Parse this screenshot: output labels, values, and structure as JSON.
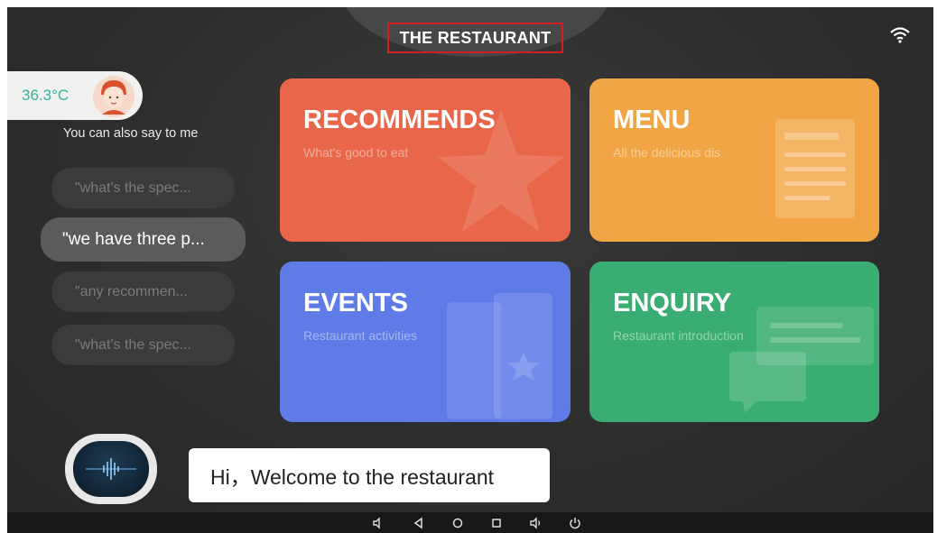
{
  "header": {
    "title": "THE RESTAURANT"
  },
  "status": {
    "temperature": "36.3°C"
  },
  "left_panel": {
    "hint": "You can also say to me",
    "suggestions": [
      "\"what's the spec...",
      "\"we have three p...",
      "\"any recommen...",
      "\"what's the spec..."
    ],
    "active_index": 1
  },
  "cards": [
    {
      "title": "RECOMMENDS",
      "subtitle": "What's good to eat",
      "color": "#e8674a",
      "icon": "star-icon"
    },
    {
      "title": "MENU",
      "subtitle": "All the delicious dis",
      "color": "#f2a544",
      "icon": "menu-document-icon"
    },
    {
      "title": "EVENTS",
      "subtitle": "Restaurant activities",
      "color": "#5f7be8",
      "icon": "ticket-icon"
    },
    {
      "title": "ENQUIRY",
      "subtitle": "Restaurant introduction",
      "color": "#3aad72",
      "icon": "chat-bubbles-icon"
    }
  ],
  "assistant": {
    "message": "Hi，Welcome to the restaurant"
  },
  "navbar": {
    "icons": [
      "volume-down-icon",
      "back-icon",
      "home-icon",
      "recent-apps-icon",
      "volume-up-icon",
      "power-icon"
    ]
  }
}
